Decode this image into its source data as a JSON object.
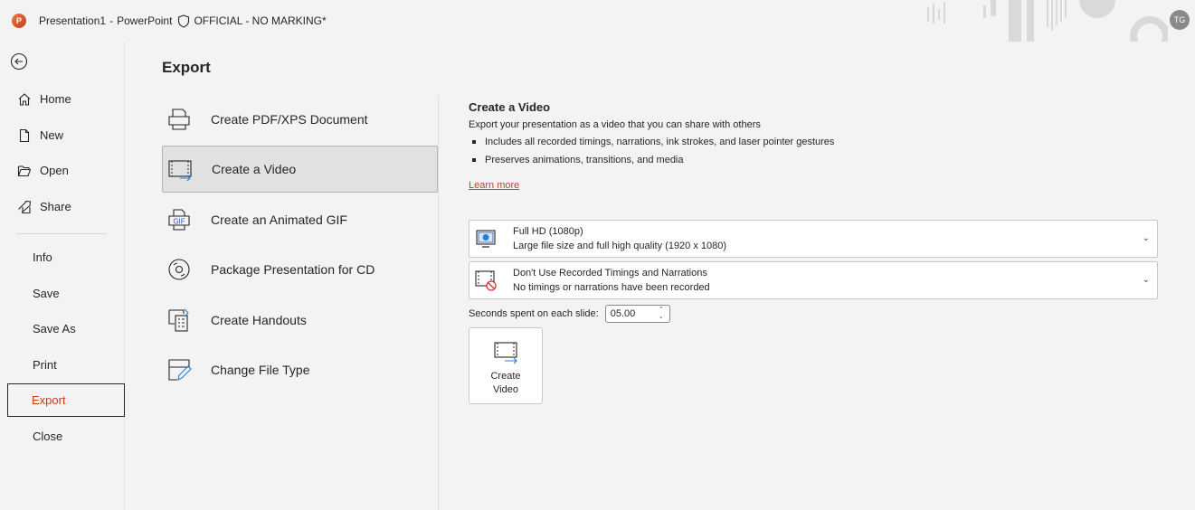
{
  "titlebar": {
    "doc_name": "Presentation1",
    "separator": "-",
    "app_name": "PowerPoint",
    "sensitivity": "OFFICIAL - NO MARKING*",
    "avatar_initials": "TG",
    "logo_letter": "P"
  },
  "nav": {
    "items": [
      {
        "label": "Home",
        "icon": "home-icon"
      },
      {
        "label": "New",
        "icon": "new-document-icon"
      },
      {
        "label": "Open",
        "icon": "folder-open-icon"
      },
      {
        "label": "Share",
        "icon": "share-icon"
      },
      {
        "label": "Info"
      },
      {
        "label": "Save"
      },
      {
        "label": "Save As"
      },
      {
        "label": "Print"
      },
      {
        "label": "Export",
        "selected": true
      },
      {
        "label": "Close"
      }
    ]
  },
  "main": {
    "title": "Export",
    "options": [
      {
        "label": "Create PDF/XPS Document",
        "icon": "pdf-document-icon"
      },
      {
        "label": "Create a Video",
        "icon": "video-export-icon",
        "selected": true
      },
      {
        "label": "Create an Animated GIF",
        "icon": "gif-icon",
        "icon_text": "GIF"
      },
      {
        "label": "Package Presentation for CD",
        "icon": "cd-icon"
      },
      {
        "label": "Create Handouts",
        "icon": "handouts-icon"
      },
      {
        "label": "Change File Type",
        "icon": "change-file-type-icon"
      }
    ]
  },
  "panel": {
    "title": "Create a Video",
    "description": "Export your presentation as a video that you can share with others",
    "bullets": [
      "Includes all recorded timings, narrations, ink strokes, and laser pointer gestures",
      "Preserves animations, transitions, and media"
    ],
    "learn_more": "Learn more",
    "quality": {
      "title": "Full HD (1080p)",
      "subtitle": "Large file size and full high quality (1920 x 1080)"
    },
    "timings": {
      "title": "Don't Use Recorded Timings and Narrations",
      "subtitle": "No timings or narrations have been recorded"
    },
    "seconds_label": "Seconds spent on each slide:",
    "seconds_value": "05.00",
    "create_button": {
      "line1": "Create",
      "line2": "Video"
    }
  },
  "colors": {
    "background": "#f3f3f3",
    "accent": "#c43e1c",
    "link": "#b7472a"
  }
}
